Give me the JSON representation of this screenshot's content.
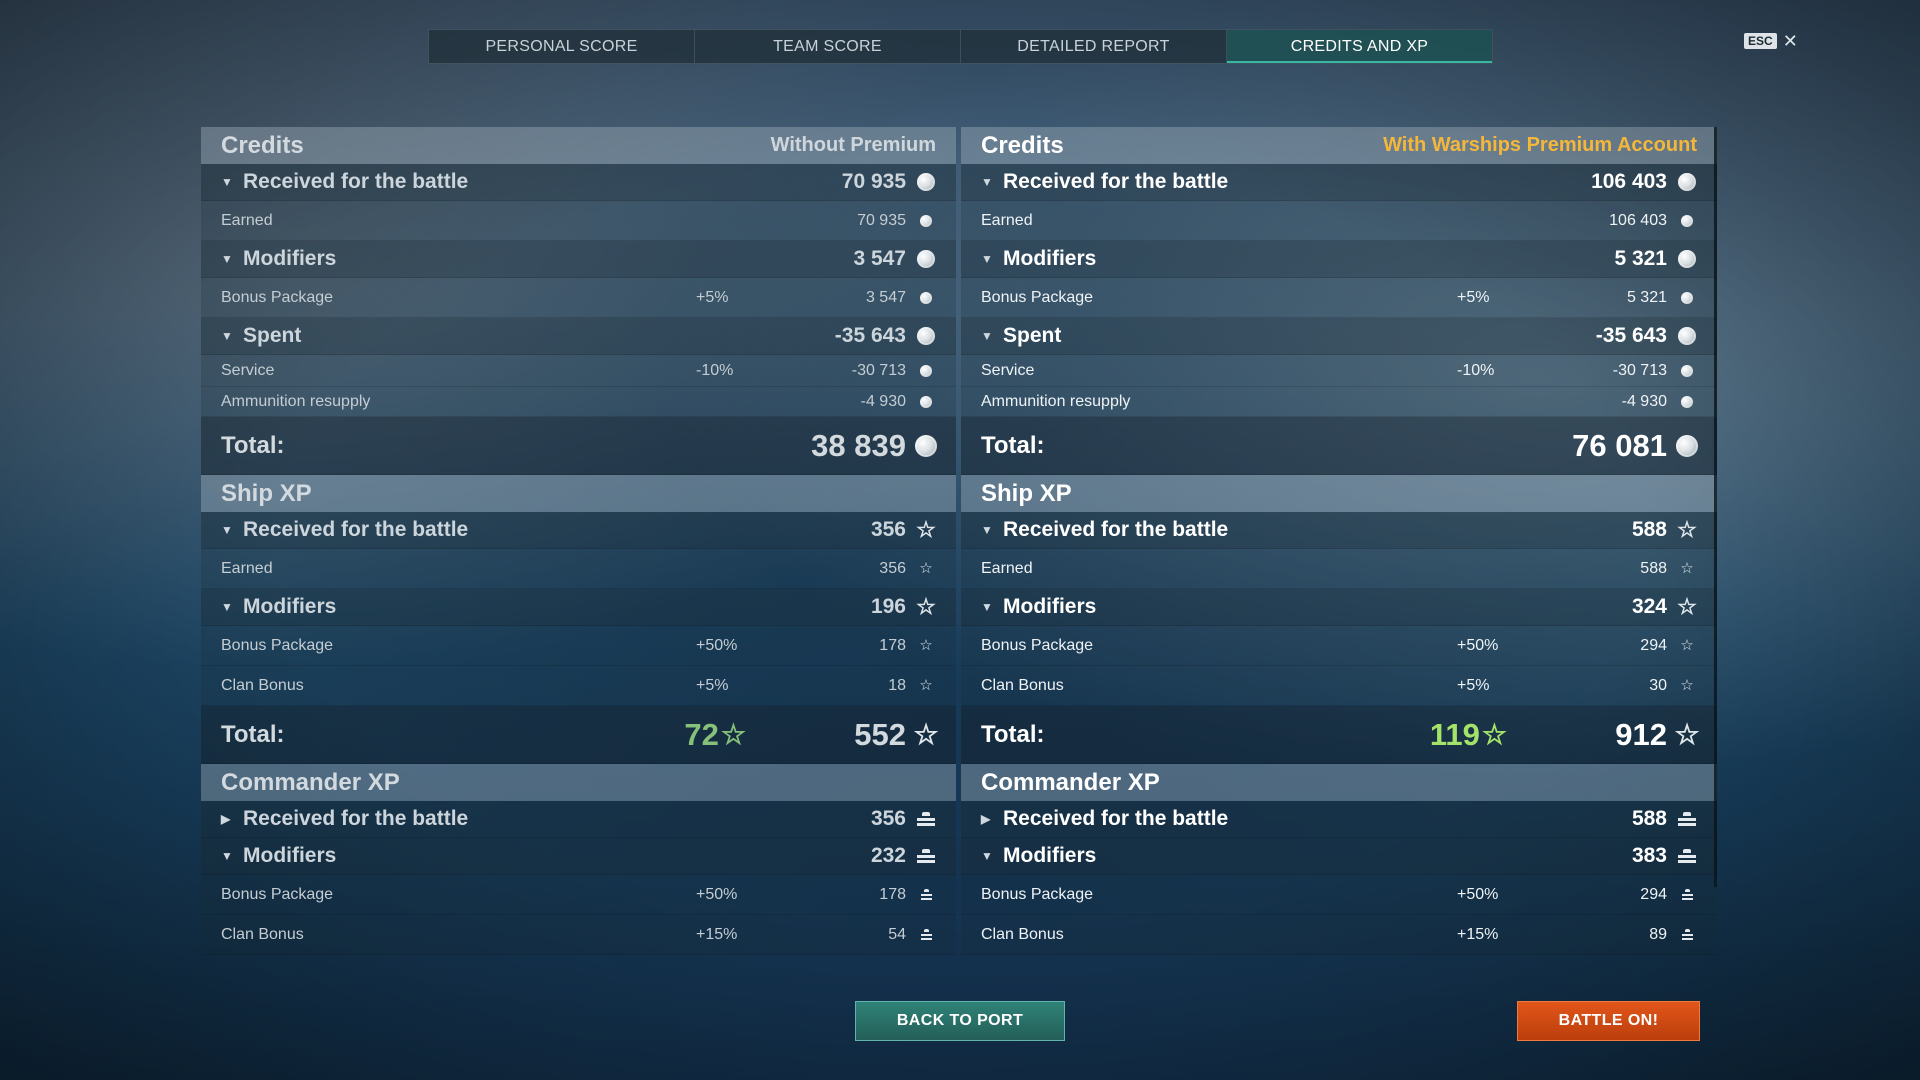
{
  "tabs": [
    {
      "label": "PERSONAL SCORE"
    },
    {
      "label": "TEAM SCORE"
    },
    {
      "label": "DETAILED REPORT"
    },
    {
      "label": "CREDITS AND XP",
      "active": true
    }
  ],
  "esc_label": "ESC",
  "left": {
    "credits": {
      "title": "Credits",
      "subtitle": "Without Premium",
      "received": {
        "label": "Received for the battle",
        "value": "70 935"
      },
      "earned": {
        "label": "Earned",
        "value": "70 935"
      },
      "modifiers": {
        "label": "Modifiers",
        "value": "3 547"
      },
      "bonus_package": {
        "label": "Bonus Package",
        "pct": "+5%",
        "value": "3 547"
      },
      "spent": {
        "label": "Spent",
        "value": "-35 643"
      },
      "service": {
        "label": "Service",
        "pct": "-10%",
        "value": "-30 713"
      },
      "ammo": {
        "label": "Ammunition resupply",
        "value": "-4 930"
      },
      "total": {
        "label": "Total:",
        "value": "38 839"
      }
    },
    "ship_xp": {
      "title": "Ship XP",
      "received": {
        "label": "Received for the battle",
        "value": "356"
      },
      "earned": {
        "label": "Earned",
        "value": "356"
      },
      "modifiers": {
        "label": "Modifiers",
        "value": "196"
      },
      "bonus_package": {
        "label": "Bonus Package",
        "pct": "+50%",
        "value": "178"
      },
      "clan_bonus": {
        "label": "Clan Bonus",
        "pct": "+5%",
        "value": "18"
      },
      "total": {
        "label": "Total:",
        "bonus": "72",
        "value": "552"
      }
    },
    "commander_xp": {
      "title": "Commander XP",
      "received": {
        "label": "Received for the battle",
        "value": "356"
      },
      "modifiers": {
        "label": "Modifiers",
        "value": "232"
      },
      "bonus_package": {
        "label": "Bonus Package",
        "pct": "+50%",
        "value": "178"
      },
      "clan_bonus": {
        "label": "Clan Bonus",
        "pct": "+15%",
        "value": "54"
      }
    }
  },
  "right": {
    "credits": {
      "title": "Credits",
      "subtitle": "With Warships Premium Account",
      "received": {
        "label": "Received for the battle",
        "value": "106 403"
      },
      "earned": {
        "label": "Earned",
        "value": "106 403"
      },
      "modifiers": {
        "label": "Modifiers",
        "value": "5 321"
      },
      "bonus_package": {
        "label": "Bonus Package",
        "pct": "+5%",
        "value": "5 321"
      },
      "spent": {
        "label": "Spent",
        "value": "-35 643"
      },
      "service": {
        "label": "Service",
        "pct": "-10%",
        "value": "-30 713"
      },
      "ammo": {
        "label": "Ammunition resupply",
        "value": "-4 930"
      },
      "total": {
        "label": "Total:",
        "value": "76 081"
      }
    },
    "ship_xp": {
      "title": "Ship XP",
      "received": {
        "label": "Received for the battle",
        "value": "588"
      },
      "earned": {
        "label": "Earned",
        "value": "588"
      },
      "modifiers": {
        "label": "Modifiers",
        "value": "324"
      },
      "bonus_package": {
        "label": "Bonus Package",
        "pct": "+50%",
        "value": "294"
      },
      "clan_bonus": {
        "label": "Clan Bonus",
        "pct": "+5%",
        "value": "30"
      },
      "total": {
        "label": "Total:",
        "bonus": "119",
        "value": "912"
      }
    },
    "commander_xp": {
      "title": "Commander XP",
      "received": {
        "label": "Received for the battle",
        "value": "588"
      },
      "modifiers": {
        "label": "Modifiers",
        "value": "383"
      },
      "bonus_package": {
        "label": "Bonus Package",
        "pct": "+50%",
        "value": "294"
      },
      "clan_bonus": {
        "label": "Clan Bonus",
        "pct": "+15%",
        "value": "89"
      }
    }
  },
  "buttons": {
    "back": "BACK TO PORT",
    "battle": "BATTLE ON!"
  },
  "colors": {
    "premium_accent": "#f5b73a",
    "active_tab": "#205a5a",
    "battle_button": "#e2561a",
    "back_button": "#2f8278",
    "bonus_xp": "#a4e36a"
  },
  "icons": {
    "credits": "credit-coin-icon",
    "xp": "xp-star-icon",
    "commander_xp": "commander-xp-icon",
    "expanded": "chevron-down-icon",
    "collapsed": "chevron-right-icon"
  }
}
